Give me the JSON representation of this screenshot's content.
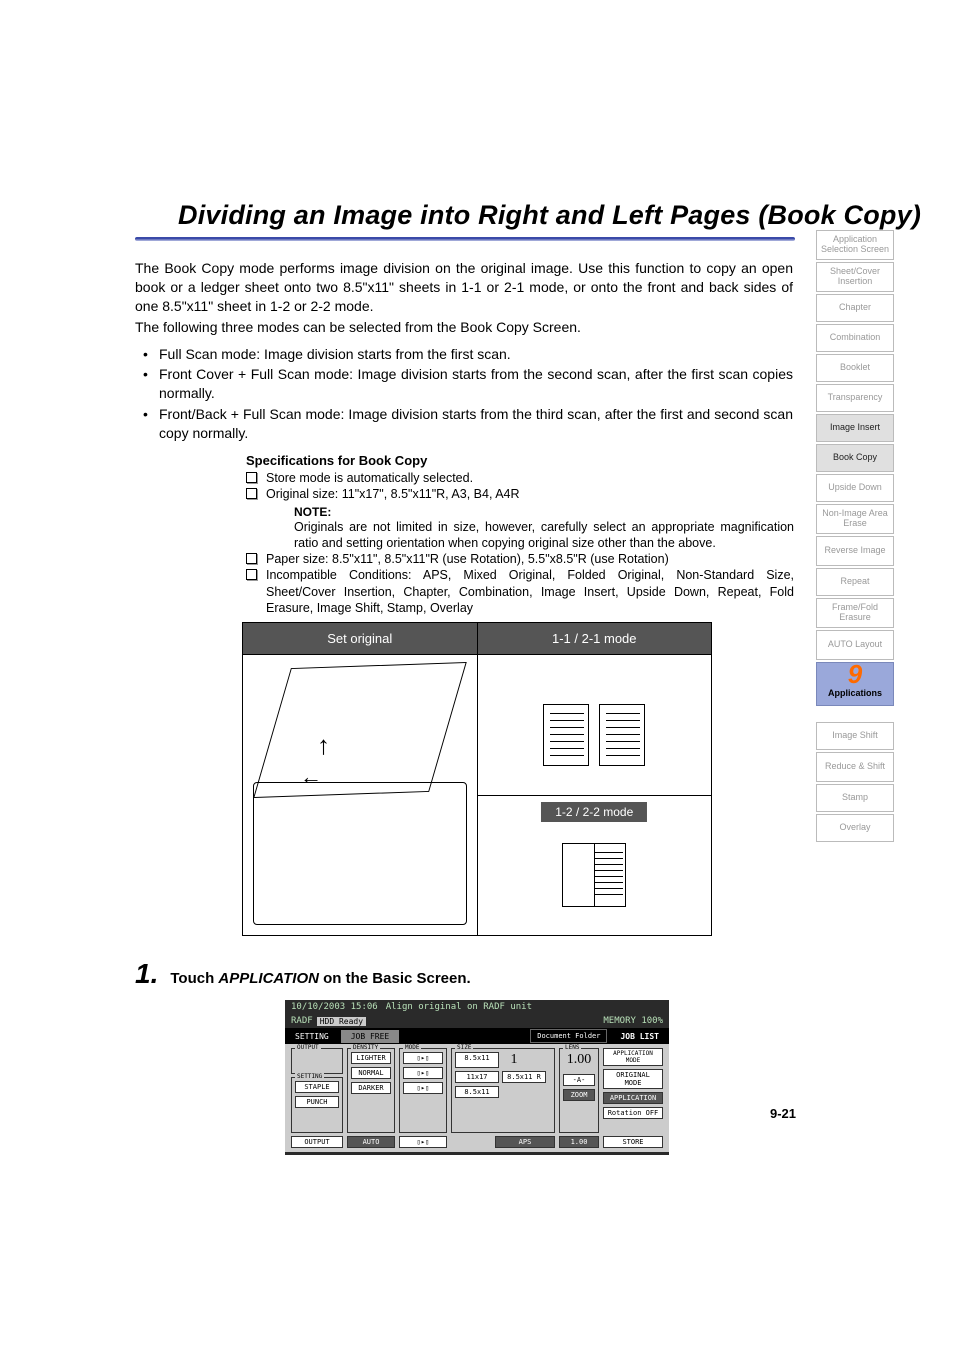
{
  "page_title": "Dividing an Image into Right and Left Pages (Book Copy)",
  "intro": {
    "p1": "The Book Copy mode performs image division on the original image. Use this function to copy an open book or a ledger sheet onto two 8.5\"x11\" sheets in 1-1 or 2-1 mode, or onto the front and back sides of one 8.5\"x11\" sheet in 1-2 or 2-2 mode.",
    "p2": "The following three modes can be selected from the Book Copy Screen."
  },
  "bullets": [
    "Full Scan mode: Image division starts from the first scan.",
    "Front Cover + Full Scan mode: Image division starts from the second scan, after the first scan copies normally.",
    "Front/Back + Full Scan mode: Image division starts from the third scan, after the first and second scan copy normally."
  ],
  "spec": {
    "title": "Specifications for Book Copy",
    "items": [
      "Store mode is automatically selected.",
      "Original size: 11\"x17\", 8.5\"x11\"R, A3, B4, A4R"
    ],
    "note_label": "NOTE:",
    "note_text": "Originals are not limited in size, however, carefully select an appropriate magnification ratio and setting orientation when copying original size other than the above.",
    "items2": [
      "Paper size: 8.5\"x11\", 8.5\"x11\"R (use Rotation), 5.5\"x8.5\"R (use Rotation)",
      "Incompatible Conditions: APS, Mixed Original, Folded Original, Non-Standard Size, Sheet/Cover Insertion, Chapter, Combination, Image Insert, Upside Down, Repeat, Fold Erasure, Image Shift, Stamp, Overlay"
    ]
  },
  "illustration": {
    "left_header": "Set original",
    "right_header": "1-1 / 2-1 mode",
    "right_bottom": "1-2 / 2-2 mode"
  },
  "step": {
    "num": "1.",
    "prefix": "Touch ",
    "keyword": "APPLICATION",
    "suffix": " on the Basic Screen."
  },
  "screen": {
    "datetime": "10/10/2003 15:06",
    "msg": "Align original on RADF unit",
    "radf": "RADF",
    "hdd": "HDD Ready",
    "memory": "MEMORY 100%",
    "tabs": {
      "setting": "SETTING",
      "job_free": "JOB FREE",
      "doc_folder": "Document Folder",
      "job_list": "JOB LIST"
    },
    "left": {
      "output_legend": "OUTPUT",
      "setting_legend": "SETTING",
      "staple": "STAPLE",
      "punch": "PUNCH",
      "output_btn": "OUTPUT"
    },
    "density": {
      "legend": "DENSITY",
      "lighter": "LIGHTER",
      "normal": "NORMAL",
      "darker": "DARKER",
      "auto": "AUTO"
    },
    "mode_legend": "MODE",
    "size": {
      "legend": "SIZE",
      "a": "8.5x11",
      "b": "11x17",
      "c": "8.5x11 R",
      "d": "8.5x11",
      "aps": "APS",
      "count": "1"
    },
    "lens": {
      "legend": "LENS",
      "value": "1.00",
      "dash": "-A-",
      "zoom": "ZOOM",
      "one": "1.00"
    },
    "right": {
      "app_mode": "APPLICATION MODE",
      "orig_mode": "ORIGINAL MODE",
      "application": "APPLICATION",
      "rotation": "Rotation OFF",
      "store": "STORE"
    }
  },
  "page_number": "9-21",
  "sidebar": {
    "items": [
      "Application Selection Screen",
      "Sheet/Cover Insertion",
      "Chapter",
      "Combination",
      "Booklet",
      "Transparency",
      "Image Insert",
      "Book Copy",
      "Upside Down",
      "Non-Image Area Erase",
      "Reverse Image",
      "Repeat",
      "Frame/Fold Erasure",
      "AUTO Layout"
    ],
    "highlight_num": "9",
    "highlight_label": "Applications",
    "items_after": [
      "Image Shift",
      "Reduce & Shift",
      "Stamp",
      "Overlay"
    ]
  }
}
